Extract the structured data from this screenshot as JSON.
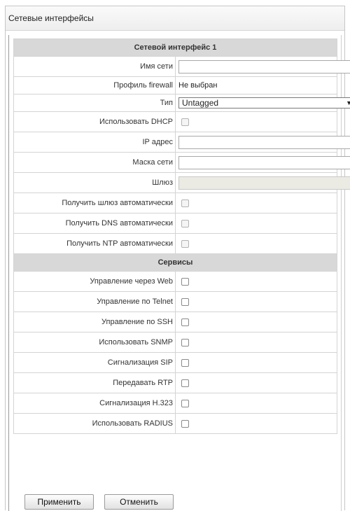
{
  "panel": {
    "title": "Сетевые интерфейсы"
  },
  "interface": {
    "section_title": "Сетевой интерфейс 1",
    "rows": {
      "name_label": "Имя сети",
      "name_value": "",
      "firewall_label": "Профиль firewall",
      "firewall_value": "Не выбран",
      "type_label": "Тип",
      "type_value": "Untagged",
      "dhcp_label": "Использовать DHCP",
      "ip_label": "IP адрес",
      "ip_value": "",
      "mask_label": "Маска сети",
      "mask_value": "",
      "gateway_label": "Шлюз",
      "gateway_value": "",
      "auto_gateway_label": "Получить шлюз автоматически",
      "auto_dns_label": "Получить DNS автоматически",
      "auto_ntp_label": "Получить NTP автоматически"
    }
  },
  "services": {
    "section_title": "Сервисы",
    "items": [
      {
        "label": "Управление через Web",
        "checked": false
      },
      {
        "label": "Управление по Telnet",
        "checked": false
      },
      {
        "label": "Управление по SSH",
        "checked": false
      },
      {
        "label": "Использовать SNMP",
        "checked": false
      },
      {
        "label": "Сигнализация SIP",
        "checked": false
      },
      {
        "label": "Передавать RTP",
        "checked": false
      },
      {
        "label": "Сигнализация H.323",
        "checked": false
      },
      {
        "label": "Использовать RADIUS",
        "checked": false
      }
    ]
  },
  "buttons": {
    "apply": "Применить",
    "cancel": "Отменить"
  }
}
